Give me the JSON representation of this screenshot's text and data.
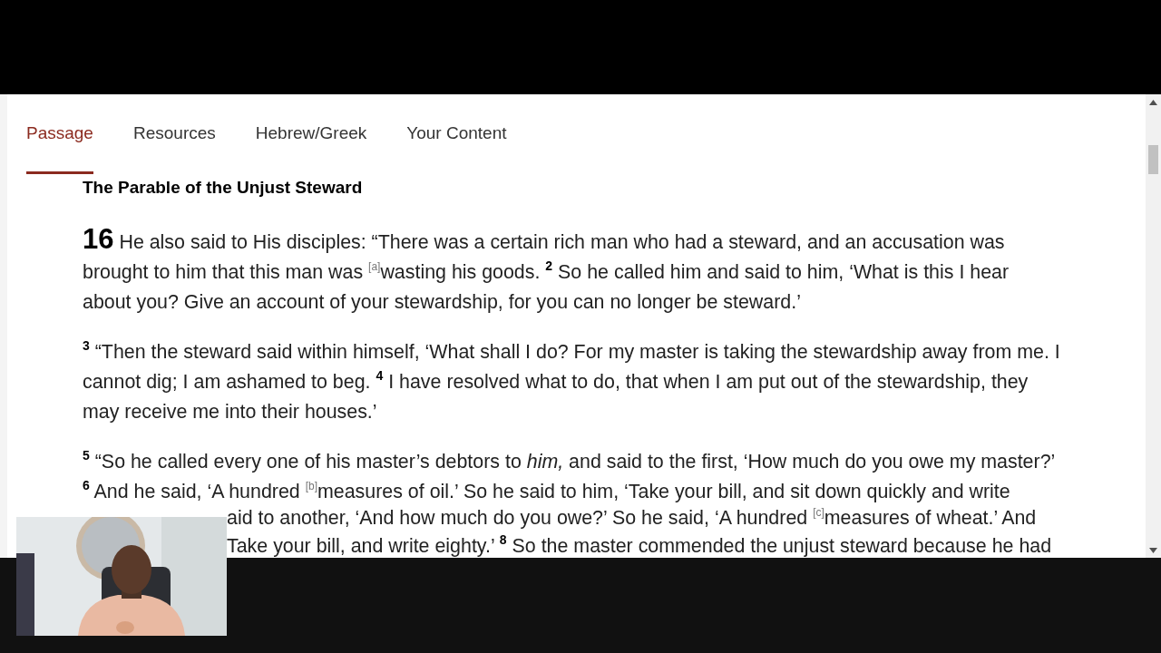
{
  "tabs": [
    {
      "label": "Passage",
      "selected": true
    },
    {
      "label": "Resources",
      "selected": false
    },
    {
      "label": "Hebrew/Greek",
      "selected": false
    },
    {
      "label": "Your Content",
      "selected": false
    }
  ],
  "heading": "The Parable of the Unjust Steward",
  "paragraphs": [
    {
      "lines": [
        "**16** He also said to His disciples: “There was a certain rich man who had a steward, and an accusation was",
        "brought to him that this man was $^{[a]}$wasting his goods. **$^{2}$** So he called him and said to him, ‘What is this I hear",
        "about you? Give an account of your stewardship, for you can no longer be steward.’"
      ]
    },
    {
      "lines": [
        "**$^{3}$** “Then the steward said within himself, ‘What shall I do? For my master is taking the stewardship away from me. I",
        "cannot dig; I am ashamed to beg. **$^{4}$** I have resolved what to do, that when I am put out of the stewardship, they",
        "may receive me into their houses.’"
      ]
    },
    {
      "lines": [
        "**$^{5}$** “So he called every one of his master’s debtors to *him,* and said to the first, ‘How much do you owe my master?’",
        "**$^{6}$** And he said, ‘A hundred $^{[b]}$measures of oil.’ So he said to him, ‘Take your bill, and sit down quickly and write"
      ]
    },
    {
      "kind": "partial",
      "lines": [
        "aid to another, ‘And how much do you owe?’ So he said, ‘A hundred $^{[c]}$measures of wheat.’ And",
        "Take your bill, and write eighty.’ **$^{8}$** So the master commended the unjust steward because he had"
      ]
    }
  ]
}
